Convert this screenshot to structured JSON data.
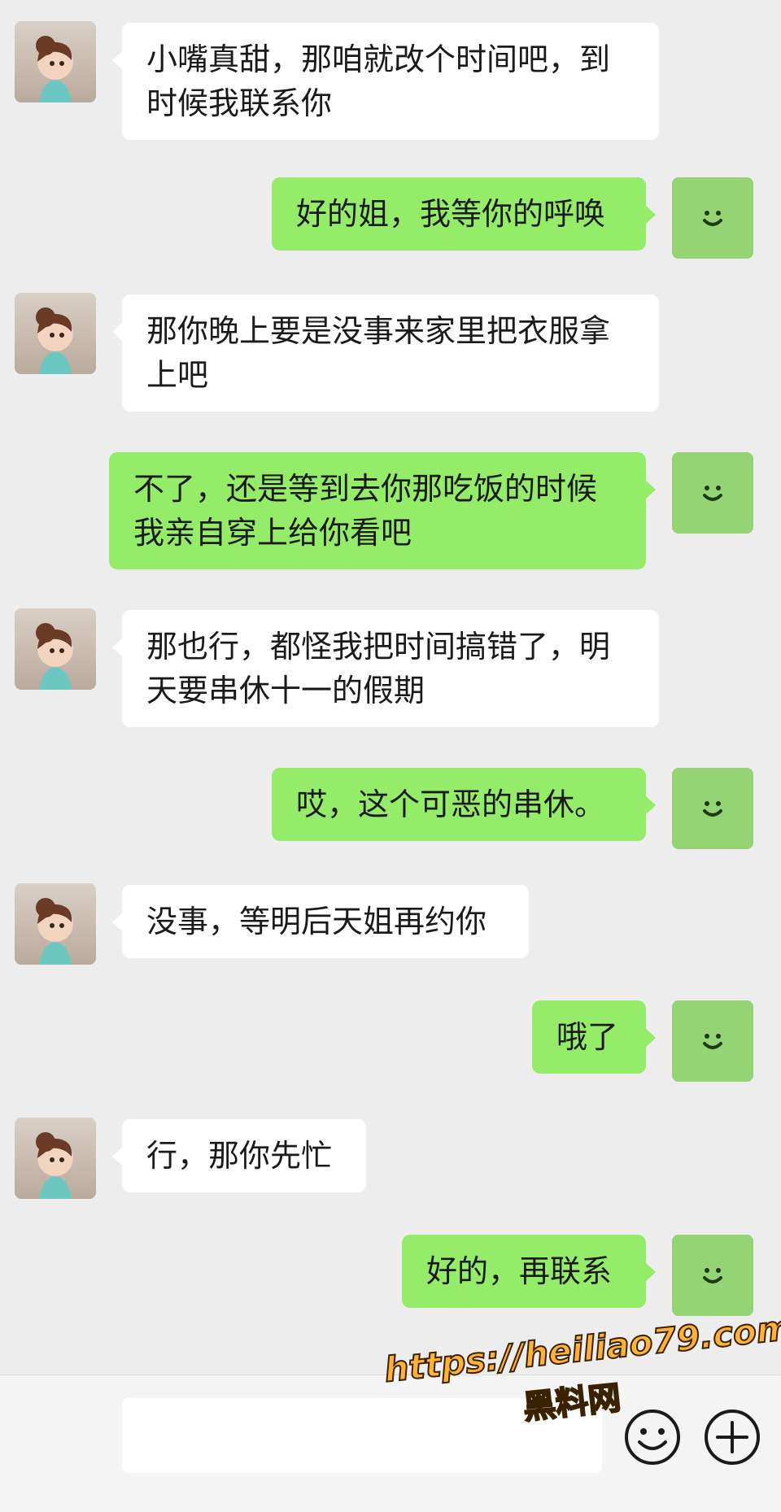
{
  "messages": [
    {
      "side": "in",
      "text": "小嘴真甜，那咱就改个时间吧，到时候我联系你"
    },
    {
      "side": "out",
      "text": "好的姐，我等你的呼唤"
    },
    {
      "side": "in",
      "text": "那你晚上要是没事来家里把衣服拿上吧"
    },
    {
      "side": "out",
      "text": "不了，还是等到去你那吃饭的时候我亲自穿上给你看吧"
    },
    {
      "side": "in",
      "text": "那也行，都怪我把时间搞错了，明天要串休十一的假期"
    },
    {
      "side": "out",
      "text": "哎，这个可恶的串休。"
    },
    {
      "side": "in",
      "text": "没事，等明后天姐再约你"
    },
    {
      "side": "out",
      "text": "哦了"
    },
    {
      "side": "in",
      "text": "行，那你先忙"
    },
    {
      "side": "out",
      "text": "好的，再联系"
    }
  ],
  "input": {
    "value": "",
    "emoji_icon": "smiley-icon",
    "more_icon": "plus-icon"
  },
  "watermark": {
    "url": "https://heiliao79.com",
    "name": "黑料网"
  },
  "colors": {
    "background": "#ededed",
    "incoming": "#ffffff",
    "outgoing": "#95ec69",
    "self_avatar": "#95d475"
  }
}
